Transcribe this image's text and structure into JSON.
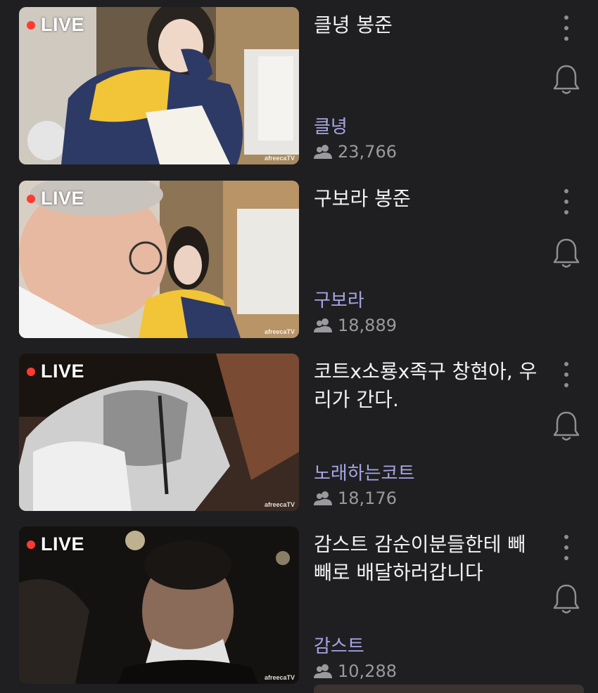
{
  "live_label": "LIVE",
  "watermark": "afreecaTV",
  "streams": [
    {
      "title": "클녕 봉준",
      "channel": "클녕",
      "viewers": "23,766"
    },
    {
      "title": "구보라 봉준",
      "channel": "구보라",
      "viewers": "18,889"
    },
    {
      "title": "코트x소룡x족구 창현아, 우리가 간다.",
      "channel": "노래하는코트",
      "viewers": "18,176"
    },
    {
      "title": "감스트 감순이분들한테 빼빼로 배달하러갑니다",
      "channel": "감스트",
      "viewers": "10,288"
    }
  ],
  "icons": {
    "more": "more-vertical-icon",
    "bell": "bell-icon",
    "viewers": "people-icon"
  },
  "colors": {
    "background": "#1f1f21",
    "channel": "#a7a5e6",
    "live_dot": "#ff3b30",
    "meta": "#9a9a9e"
  }
}
